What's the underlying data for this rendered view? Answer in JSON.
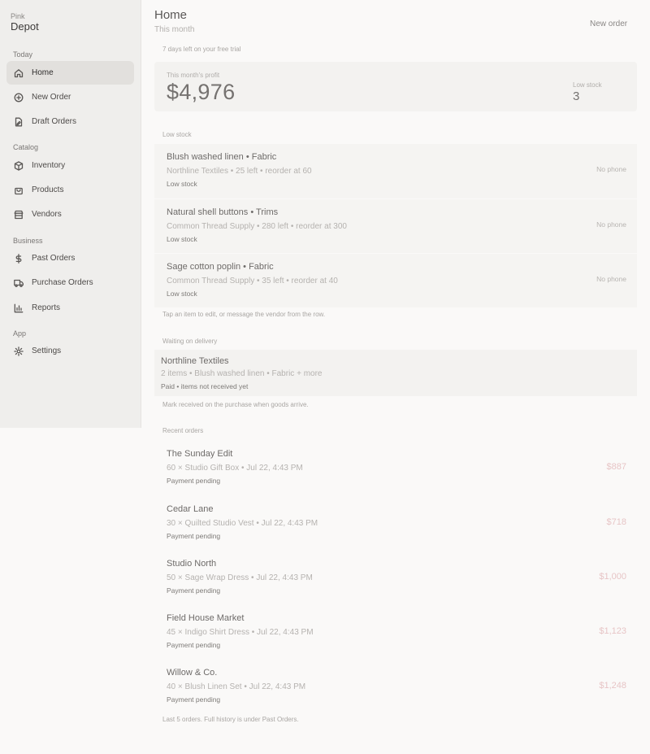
{
  "sidebar": {
    "brand_sub": "Pink",
    "brand_name": "Depot",
    "sections": {
      "today": "Today",
      "catalog": "Catalog",
      "business": "Business",
      "app": "App"
    },
    "items": {
      "home": "Home",
      "new_order": "New Order",
      "draft_orders": "Draft Orders",
      "inventory": "Inventory",
      "products": "Products",
      "vendors": "Vendors",
      "past_orders": "Past Orders",
      "purchase_orders": "Purchase Orders",
      "reports": "Reports",
      "settings": "Settings"
    },
    "icons": [
      "home-icon",
      "plus-circle-icon",
      "draft-icon",
      "box-icon",
      "bag-icon",
      "store-icon",
      "dollar-icon",
      "truck-icon",
      "bar-chart-icon",
      "gear-icon"
    ]
  },
  "header": {
    "title": "Home",
    "subtitle": "This month",
    "new_order_label": "New order"
  },
  "trial_text": "7 days left on your free trial",
  "profit": {
    "label": "This month's profit",
    "value": "$4,976",
    "low_stock_label": "Low stock",
    "low_stock_value": "3"
  },
  "low_stock": {
    "heading": "Low stock",
    "items": [
      {
        "title": "Blush washed linen • Fabric",
        "sub": "Northline Textiles • 25 left • reorder at 60",
        "tag": "Low stock",
        "right": "No phone"
      },
      {
        "title": "Natural shell buttons • Trims",
        "sub": "Common Thread Supply • 280 left • reorder at 300",
        "tag": "Low stock",
        "right": "No phone"
      },
      {
        "title": "Sage cotton poplin • Fabric",
        "sub": "Common Thread Supply • 35 left • reorder at 40",
        "tag": "Low stock",
        "right": "No phone"
      }
    ],
    "footnote": "Tap an item to edit, or message the vendor from the row."
  },
  "delivery": {
    "heading": "Waiting on delivery",
    "title": "Northline Textiles",
    "sub": "2 items • Blush washed linen • Fabric + more",
    "tag": "Paid • items not received yet",
    "footnote": "Mark received on the purchase when goods arrive."
  },
  "orders": {
    "heading": "Recent orders",
    "items": [
      {
        "title": "The Sunday Edit",
        "sub": "60 × Studio Gift Box • Jul 22, 4:43 PM",
        "tag": "Payment pending",
        "amount": "$887"
      },
      {
        "title": "Cedar Lane",
        "sub": "30 × Quilted Studio Vest • Jul 22, 4:43 PM",
        "tag": "Payment pending",
        "amount": "$718"
      },
      {
        "title": "Studio North",
        "sub": "50 × Sage Wrap Dress • Jul 22, 4:43 PM",
        "tag": "Payment pending",
        "amount": "$1,000"
      },
      {
        "title": "Field House Market",
        "sub": "45 × Indigo Shirt Dress • Jul 22, 4:43 PM",
        "tag": "Payment pending",
        "amount": "$1,123"
      },
      {
        "title": "Willow & Co.",
        "sub": "40 × Blush Linen Set • Jul 22, 4:43 PM",
        "tag": "Payment pending",
        "amount": "$1,248"
      }
    ],
    "footnote": "Last 5 orders. Full history is under Past Orders."
  },
  "colors": {
    "sidebar_bg": "#efeeec",
    "active_item_bg": "#e2e0dd",
    "amount_pink": "#e7c5c6"
  }
}
